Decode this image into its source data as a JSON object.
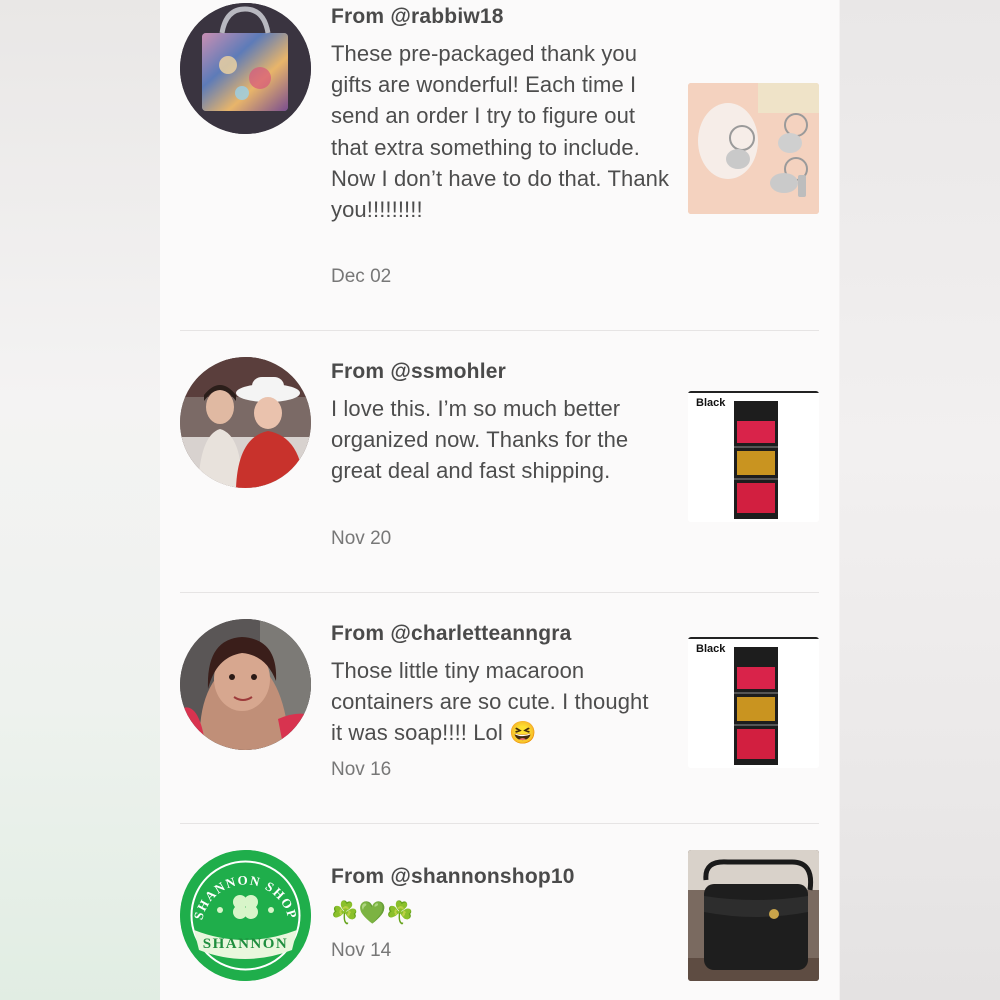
{
  "reviews": [
    {
      "from": "From @rabbiw18",
      "message": "These pre-packaged thank you gifts are wonderful! Each time I send an order I try to figure out that extra something to include. Now I don’t have to do that. Thank you!!!!!!!!!",
      "date": "Dec 02",
      "avatar_icon": "tote-bag-photo",
      "thumb_icon": "keychains-photo"
    },
    {
      "from": "From @ssmohler",
      "message": "I love this. I’m so much better organized now. Thanks for the great deal and fast shipping.",
      "date": "Nov 20",
      "avatar_icon": "two-women-photo",
      "thumb_icon": "purse-organizer-photo",
      "thumb_label": "Black"
    },
    {
      "from": "From @charletteanngra",
      "message": "Those little tiny macaroon containers are so cute. I thought it was soap!!!! Lol 😆",
      "date": "Nov 16",
      "avatar_icon": "woman-selfie-photo",
      "thumb_icon": "purse-organizer-photo",
      "thumb_label": "Black"
    },
    {
      "from": "From @shannonshop10",
      "message": "☘️💚☘️",
      "date": "Nov 14",
      "avatar_icon": "shannon-shop-logo",
      "avatar_text_top": "SHANNON SHOP",
      "avatar_text_banner": "SHANNON",
      "thumb_icon": "black-crossbody-bag-photo"
    }
  ],
  "colors": {
    "text": "#4d4d4d",
    "date": "#777777",
    "logo_green": "#1fae4b"
  }
}
